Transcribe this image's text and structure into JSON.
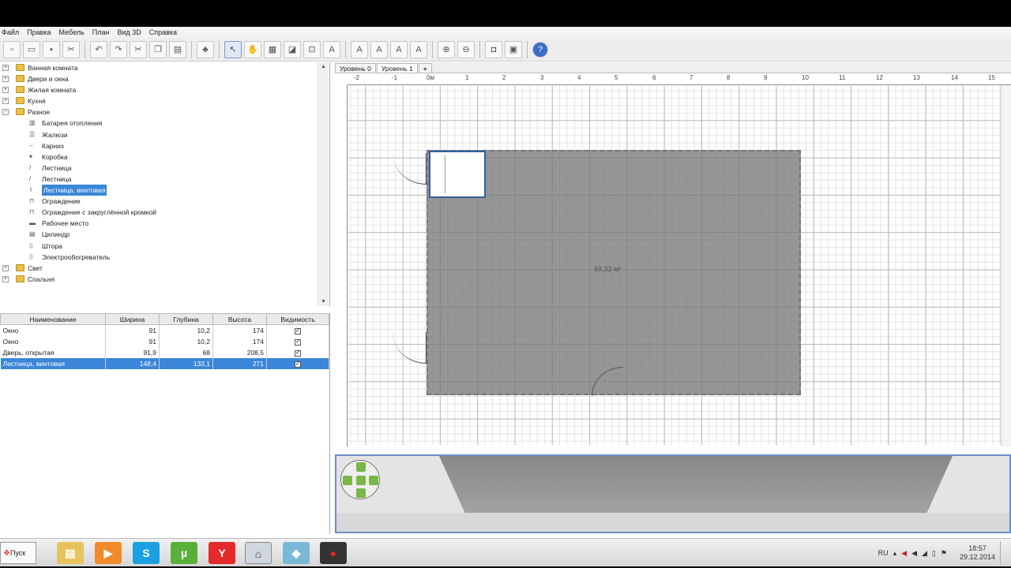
{
  "menu": [
    "Файл",
    "Правка",
    "Мебель",
    "План",
    "Вид 3D",
    "Справка"
  ],
  "toolbar": {
    "icons": [
      "new-icon",
      "open-icon",
      "save-icon",
      "preferences-icon",
      "undo-icon",
      "redo-icon",
      "cut-icon",
      "copy-icon",
      "paste-icon",
      "add-furniture-icon",
      "select-icon",
      "pan-icon",
      "create-walls-icon",
      "create-rooms-icon",
      "create-dimensions-icon",
      "add-text-icon",
      "text-style-icon",
      "increase-text-icon",
      "decrease-text-icon",
      "bold-text-icon",
      "zoom-in-icon",
      "zoom-out-icon",
      "create-photo-icon",
      "create-video-icon",
      "help-icon"
    ]
  },
  "catalog": {
    "categories_top": [
      "Ванная комната",
      "Двери и окна",
      "Жилая комната",
      "Кухня",
      "Разное"
    ],
    "items": [
      {
        "label": "Батарея отопления",
        "icon": "radiator-icon"
      },
      {
        "label": "Жалюзи",
        "icon": "blinds-icon"
      },
      {
        "label": "Карниз",
        "icon": "cornice-icon"
      },
      {
        "label": "Коробка",
        "icon": "box-icon"
      },
      {
        "label": "Лестница",
        "icon": "ladder-icon"
      },
      {
        "label": "Лестница",
        "icon": "ladder-icon"
      },
      {
        "label": "Лестница, винтовая",
        "icon": "spiral-staircase-icon",
        "selected": true
      },
      {
        "label": "Ограждение",
        "icon": "railing-icon"
      },
      {
        "label": "Ограждение с закруглённой кромкой",
        "icon": "railing-rounded-icon"
      },
      {
        "label": "Рабочее место",
        "icon": "workstation-icon"
      },
      {
        "label": "Цилиндр",
        "icon": "cylinder-icon"
      },
      {
        "label": "Штора",
        "icon": "curtain-icon"
      },
      {
        "label": "Электрообогреватель",
        "icon": "heater-icon"
      }
    ],
    "categories_bottom": [
      "Свет",
      "Спальня"
    ]
  },
  "furniture_table": {
    "headers": [
      "Наименование",
      "Ширина",
      "Глубина",
      "Высота",
      "Видимость"
    ],
    "rows": [
      {
        "name": "Окно",
        "width": "91",
        "depth": "10,2",
        "height": "174",
        "visible": true
      },
      {
        "name": "Окно",
        "width": "91",
        "depth": "10,2",
        "height": "174",
        "visible": true
      },
      {
        "name": "Дверь, открытая",
        "width": "91,9",
        "depth": "68",
        "height": "208,5",
        "visible": true
      },
      {
        "name": "Лестница, винтовая",
        "width": "148,4",
        "depth": "133,1",
        "height": "271",
        "visible": true,
        "selected": true
      }
    ]
  },
  "plan": {
    "tabs": [
      "Уровень 0",
      "Уровень 1",
      "+"
    ],
    "active_tab": 1,
    "ruler_labels": [
      "-2",
      "-1",
      "0м",
      "1",
      "2",
      "3",
      "4",
      "5",
      "6",
      "7",
      "8",
      "9",
      "10",
      "11",
      "12",
      "13",
      "14",
      "15"
    ],
    "room_area": "69,33 м²"
  },
  "taskbar": {
    "start_label": "Пуск",
    "language": "RU",
    "time": "18:57",
    "date": "29.12.2014",
    "apps": [
      "explorer-icon",
      "media-player-icon",
      "skype-icon",
      "utorrent-icon",
      "yandex-browser-icon",
      "sweet-home-3d-icon",
      "app-icon",
      "record-icon"
    ]
  }
}
